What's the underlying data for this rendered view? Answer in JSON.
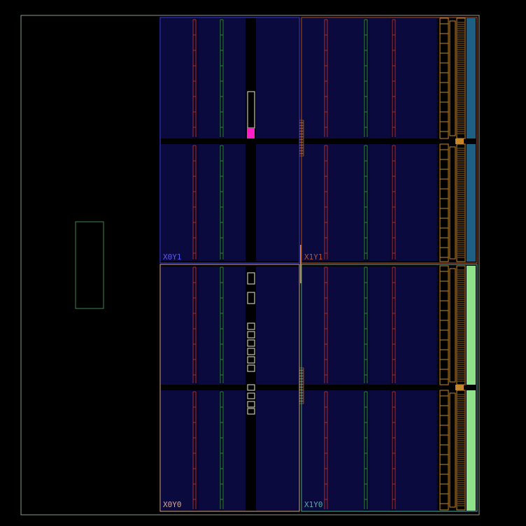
{
  "device_view": {
    "regions": [
      {
        "label": "X0Y1",
        "color": "#3c3cff"
      },
      {
        "label": "X1Y1",
        "color": "#c0502a"
      },
      {
        "label": "X0Y0",
        "color": "#d8a890"
      },
      {
        "label": "X1Y0",
        "color": "#4fb0a6"
      }
    ],
    "colors": {
      "background": "#000000",
      "fabric": "#06062e",
      "outline": "#8a9a8a",
      "pblock": "#3a8a4a",
      "clb_column_red": "#b02828",
      "clb_column_green": "#2a8a2a",
      "io_bank": "#c8862a",
      "gt_top": "#1e5f84",
      "gt_bottom": "#90e28a",
      "placed_cell": "#ff1ec8",
      "cell_outline": "#e8e8d0"
    }
  }
}
